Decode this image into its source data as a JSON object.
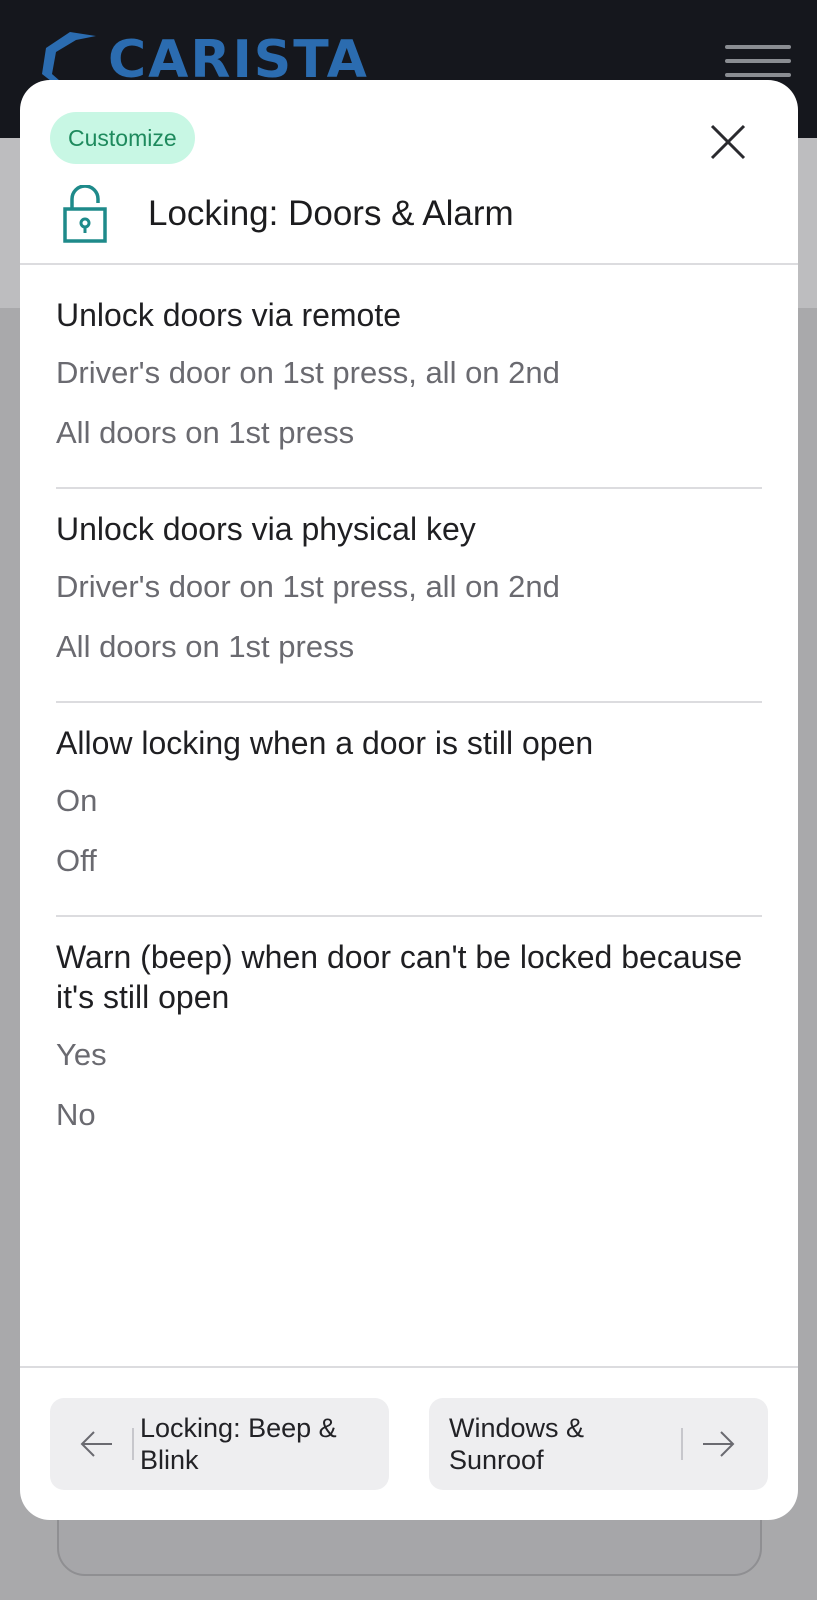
{
  "brand": {
    "name": "CARISTA"
  },
  "modal": {
    "badge": "Customize",
    "title": "Locking: Doors & Alarm",
    "icon": "unlocked-padlock-icon",
    "accent_color": "#1e8a8a",
    "badge_color": "#c8f7e4"
  },
  "settings": [
    {
      "title": "Unlock doors via remote",
      "options": [
        "Driver's door on 1st press, all on 2nd",
        "All doors on 1st press"
      ]
    },
    {
      "title": "Unlock doors via physical key",
      "options": [
        "Driver's door on 1st press, all on 2nd",
        "All doors on 1st press"
      ]
    },
    {
      "title": "Allow locking when a door is still open",
      "options": [
        "On",
        "Off"
      ]
    },
    {
      "title": "Warn (beep) when door can't be locked because it's still open",
      "options": [
        "Yes",
        "No"
      ]
    }
  ],
  "footer": {
    "prev_label": "Locking: Beep & Blink",
    "next_label": "Windows & Sunroof"
  }
}
